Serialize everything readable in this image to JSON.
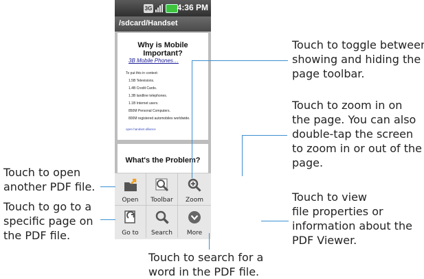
{
  "status_bar": {
    "time": "4:36 PM",
    "network": "3G"
  },
  "title_bar": {
    "path": "/sdcard/Handset"
  },
  "document": {
    "page1": {
      "heading": "Why is Mobile Important?",
      "subheading": "3B Mobile Phones…",
      "context": "To put this in context:",
      "bullets": [
        "1.5B Televisions.",
        "1.4B Credit Cards.",
        "1.3B landline telephones.",
        "1.1B Internet users.",
        "850M Personal Computers.",
        "800M registered automobiles worldwide."
      ],
      "footer": "open handset alliance"
    },
    "page2": {
      "heading": "What's the Problem?"
    }
  },
  "menu": {
    "items": [
      {
        "label": "Open",
        "icon": "open-folder-icon"
      },
      {
        "label": "Toolbar",
        "icon": "toolbar-icon"
      },
      {
        "label": "Zoom",
        "icon": "zoom-icon"
      },
      {
        "label": "Go to",
        "icon": "goto-icon"
      },
      {
        "label": "Search",
        "icon": "search-icon"
      },
      {
        "label": "More",
        "icon": "more-icon"
      }
    ]
  },
  "callouts": {
    "open": [
      "Touch to open",
      "another PDF file."
    ],
    "goto": [
      "Touch to go to a",
      "specific page on",
      "the PDF file."
    ],
    "toolbar": [
      "Touch to toggle between",
      "showing and hiding the",
      "page toolbar."
    ],
    "zoom": [
      "Touch to zoom in on",
      "the page. You can also",
      "double-tap the screen",
      "to zoom in or out of the",
      "page."
    ],
    "more": [
      "Touch to view",
      "file properties or",
      "information about the",
      "PDF Viewer."
    ],
    "search": [
      "Touch to search for a",
      "word in the PDF file."
    ]
  },
  "colors": {
    "accent_line": "#3a8fd0",
    "battery": "#3ec43e",
    "menu_bg": "#e7e7e7"
  }
}
